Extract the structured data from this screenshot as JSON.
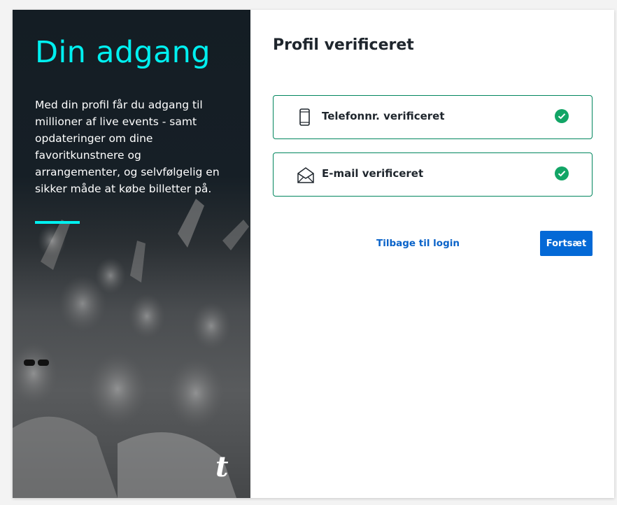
{
  "left_panel": {
    "title": "Din adgang",
    "description": "Med din profil får du adgang til millioner af live events - samt opdateringer om dine favoritkunstnere og arrangementer, og selvfølgelig en sikker måde at købe billetter på.",
    "accent_color": "#00f0f0",
    "logo_letter": "t"
  },
  "main": {
    "title": "Profil verificeret",
    "verifications": [
      {
        "label": "Telefonnr. verificeret",
        "icon": "phone-icon",
        "status": "verified"
      },
      {
        "label": "E-mail verificeret",
        "icon": "envelope-icon",
        "status": "verified"
      }
    ],
    "back_link": "Tilbage til login",
    "continue_button": "Fortsæt"
  },
  "colors": {
    "success": "#12a566",
    "border_success": "#02865e",
    "primary": "#0469d6",
    "link": "#0a63c9"
  }
}
